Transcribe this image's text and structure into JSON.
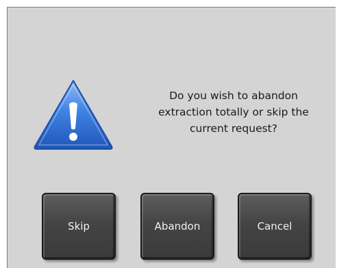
{
  "dialog": {
    "message_lines": [
      "Do you wish to abandon",
      "extraction totally or skip the",
      "current request?"
    ],
    "icon": "warning-icon",
    "colors": {
      "background": "#d4d4d4",
      "button": "#444444",
      "button_text": "#f2f2f2",
      "icon_blue": "#2f6fd6"
    }
  },
  "buttons": {
    "skip_label": "Skip",
    "abandon_label": "Abandon",
    "cancel_label": "Cancel"
  }
}
